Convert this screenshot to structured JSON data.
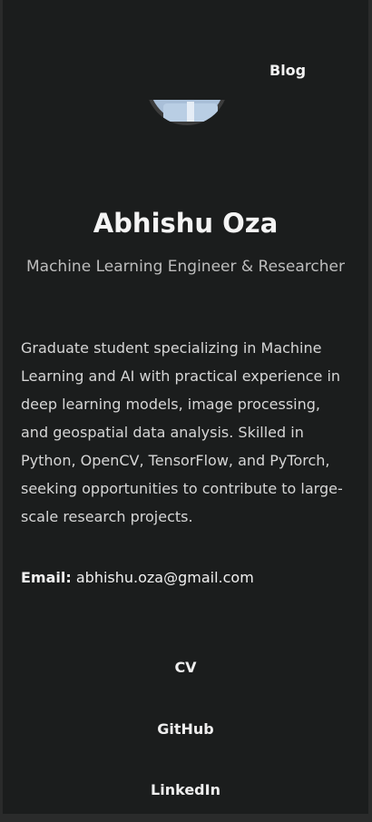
{
  "nav": {
    "blog_label": "Blog"
  },
  "profile": {
    "name": "Abhishu Oza",
    "title": "Machine Learning Engineer & Researcher",
    "bio": "Graduate student specializing in Machine Learning and AI with practical experience in deep learning models, image processing, and geospatial data analysis. Skilled in Python, OpenCV, TensorFlow, and PyTorch, seeking opportunities to contribute to large-scale research projects.",
    "email_label": "Email:",
    "email": "abhishu.oza@gmail.com"
  },
  "links": {
    "cv": "CV",
    "github": "GitHub",
    "linkedin": "LinkedIn"
  }
}
